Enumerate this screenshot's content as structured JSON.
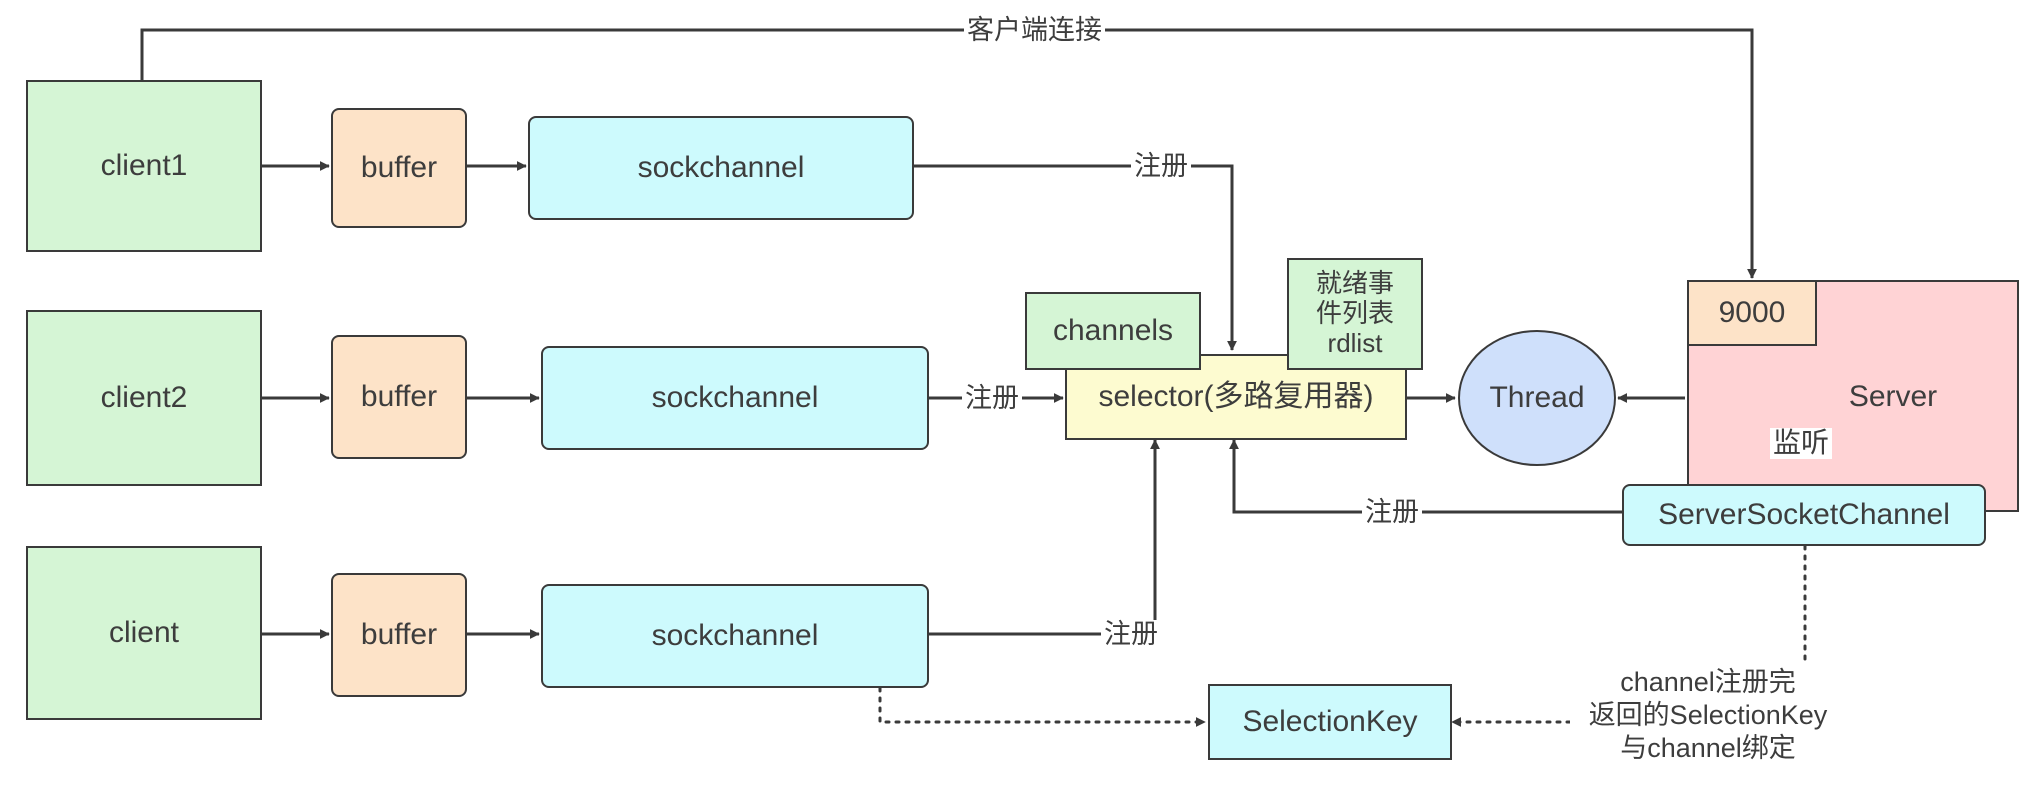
{
  "nodes": {
    "client1": "client1",
    "client2": "client2",
    "client3": "client",
    "buffer1": "buffer",
    "buffer2": "buffer",
    "buffer3": "buffer",
    "sock1": "sockchannel",
    "sock2": "sockchannel",
    "sock3": "sockchannel",
    "channels": "channels",
    "rdlist": "就绪事\n件列表\nrdlist",
    "selector": "selector(多路复用器)",
    "thread": "Thread",
    "port": "9000",
    "server": "Server",
    "server_socket_channel": "ServerSocketChannel",
    "selection_key": "SelectionKey"
  },
  "labels": {
    "client_connect": "客户端连接",
    "register1": "注册",
    "register2": "注册",
    "register3": "注册",
    "register_server": "注册",
    "listen": "监听",
    "key_note": "channel注册完\n返回的SelectionKey\n与channel绑定"
  },
  "colors": {
    "client": "#d5f5d5",
    "buffer": "#fde3c8",
    "channel": "#cdfafd",
    "selector": "#fdfbd0",
    "thread": "#cfe0fb",
    "server": "#ffd3d5",
    "line": "#3a3a3a"
  }
}
